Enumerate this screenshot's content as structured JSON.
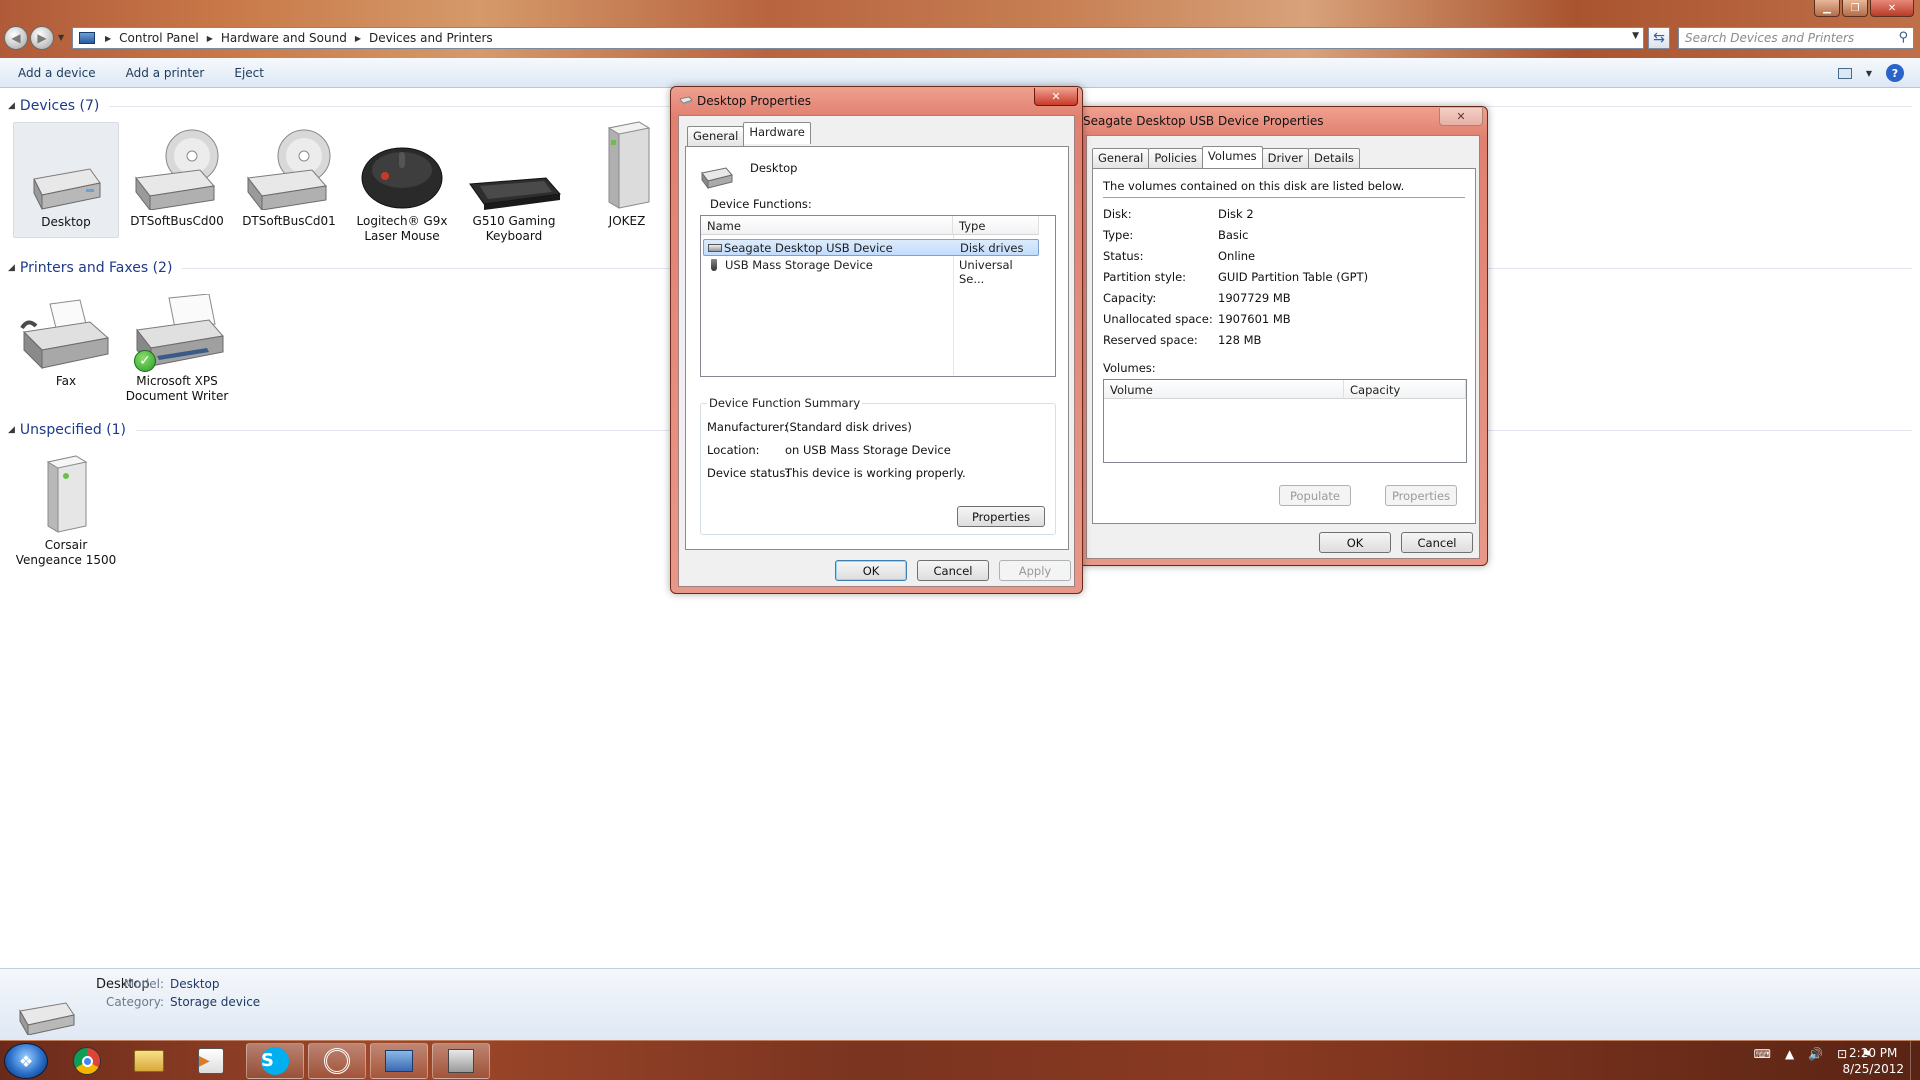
{
  "window": {
    "address": [
      "Control Panel",
      "Hardware and Sound",
      "Devices and Printers"
    ],
    "search_placeholder": "Search Devices and Printers"
  },
  "commands": [
    "Add a device",
    "Add a printer",
    "Eject"
  ],
  "groups": {
    "devices": {
      "header": "Devices (7)",
      "items": [
        {
          "line1": "Desktop",
          "line2": ""
        },
        {
          "line1": "DTSoftBusCd00",
          "line2": ""
        },
        {
          "line1": "DTSoftBusCd01",
          "line2": ""
        },
        {
          "line1": "Logitech® G9x",
          "line2": "Laser Mouse"
        },
        {
          "line1": "G510 Gaming",
          "line2": "Keyboard"
        },
        {
          "line1": "JOKEZ",
          "line2": ""
        }
      ]
    },
    "printers": {
      "header": "Printers and Faxes (2)",
      "items": [
        {
          "line1": "Fax",
          "line2": ""
        },
        {
          "line1": "Microsoft XPS",
          "line2": "Document Writer"
        }
      ]
    },
    "unspecified": {
      "header": "Unspecified (1)",
      "items": [
        {
          "line1": "Corsair",
          "line2": "Vengeance 1500"
        }
      ]
    }
  },
  "details": {
    "name": "Desktop",
    "model_label": "Model:",
    "model": "Desktop",
    "category_label": "Category:",
    "category": "Storage device"
  },
  "taskbar": {
    "time": "2:20 PM",
    "date": "8/25/2012"
  },
  "desktop_dialog": {
    "title": "Desktop Properties",
    "tabs": [
      "General",
      "Hardware"
    ],
    "device_name": "Desktop",
    "functions_label": "Device Functions:",
    "col_name": "Name",
    "col_type": "Type",
    "rows": [
      {
        "name": "Seagate Desktop USB Device",
        "type": "Disk drives"
      },
      {
        "name": "USB Mass Storage Device",
        "type": "Universal Se..."
      }
    ],
    "summary_title": "Device Function Summary",
    "manufacturer_label": "Manufacturer:",
    "manufacturer": "(Standard disk drives)",
    "location_label": "Location:",
    "location": "on USB Mass Storage Device",
    "status_label": "Device status:",
    "status": "This device is working properly.",
    "properties_btn": "Properties",
    "ok": "OK",
    "cancel": "Cancel",
    "apply": "Apply"
  },
  "seagate_dialog": {
    "title": "Seagate Desktop USB Device Properties",
    "tabs": [
      "General",
      "Policies",
      "Volumes",
      "Driver",
      "Details"
    ],
    "intro": "The volumes contained on this disk are listed below.",
    "props": [
      {
        "label": "Disk:",
        "value": "Disk 2"
      },
      {
        "label": "Type:",
        "value": "Basic"
      },
      {
        "label": "Status:",
        "value": "Online"
      },
      {
        "label": "Partition style:",
        "value": "GUID Partition Table (GPT)"
      },
      {
        "label": "Capacity:",
        "value": "1907729 MB"
      },
      {
        "label": "Unallocated space:",
        "value": "1907601 MB"
      },
      {
        "label": "Reserved space:",
        "value": "128 MB"
      }
    ],
    "volumes_label": "Volumes:",
    "col_volume": "Volume",
    "col_capacity": "Capacity",
    "populate": "Populate",
    "properties": "Properties",
    "ok": "OK",
    "cancel": "Cancel"
  }
}
